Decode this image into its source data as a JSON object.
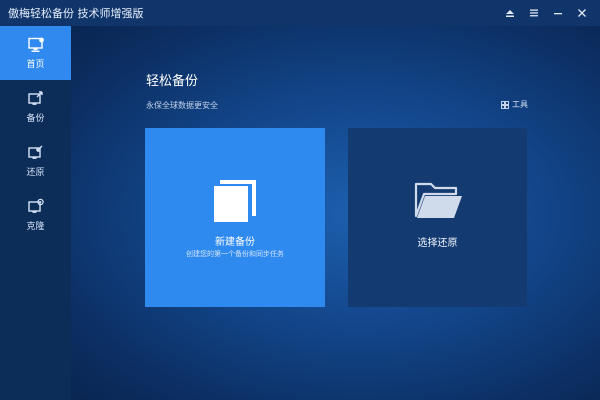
{
  "window": {
    "title": "傲梅轻松备份 技术师增强版",
    "controls": [
      "upgrade-icon",
      "menu-icon",
      "minimize-icon",
      "close-icon"
    ]
  },
  "sidebar": {
    "items": [
      {
        "label": "首页",
        "icon": "home-monitor-icon",
        "active": true
      },
      {
        "label": "备份",
        "icon": "backup-icon",
        "active": false
      },
      {
        "label": "还原",
        "icon": "restore-icon",
        "active": false
      },
      {
        "label": "克隆",
        "icon": "clone-icon",
        "active": false
      }
    ]
  },
  "main": {
    "title": "轻松备份",
    "subtitle": "永保全球数据更安全",
    "tools_label": "工具",
    "cards": [
      {
        "title": "新建备份",
        "description": "创建您的第一个备份和同步任务",
        "icon": "copy-icon"
      },
      {
        "title": "选择还原",
        "icon": "folder-open-icon"
      }
    ]
  },
  "colors": {
    "accent": "#2f8af0",
    "sidebar_bg": "#0d2d59",
    "titlebar_bg": "#10356a",
    "card_dark": "#143a72"
  }
}
